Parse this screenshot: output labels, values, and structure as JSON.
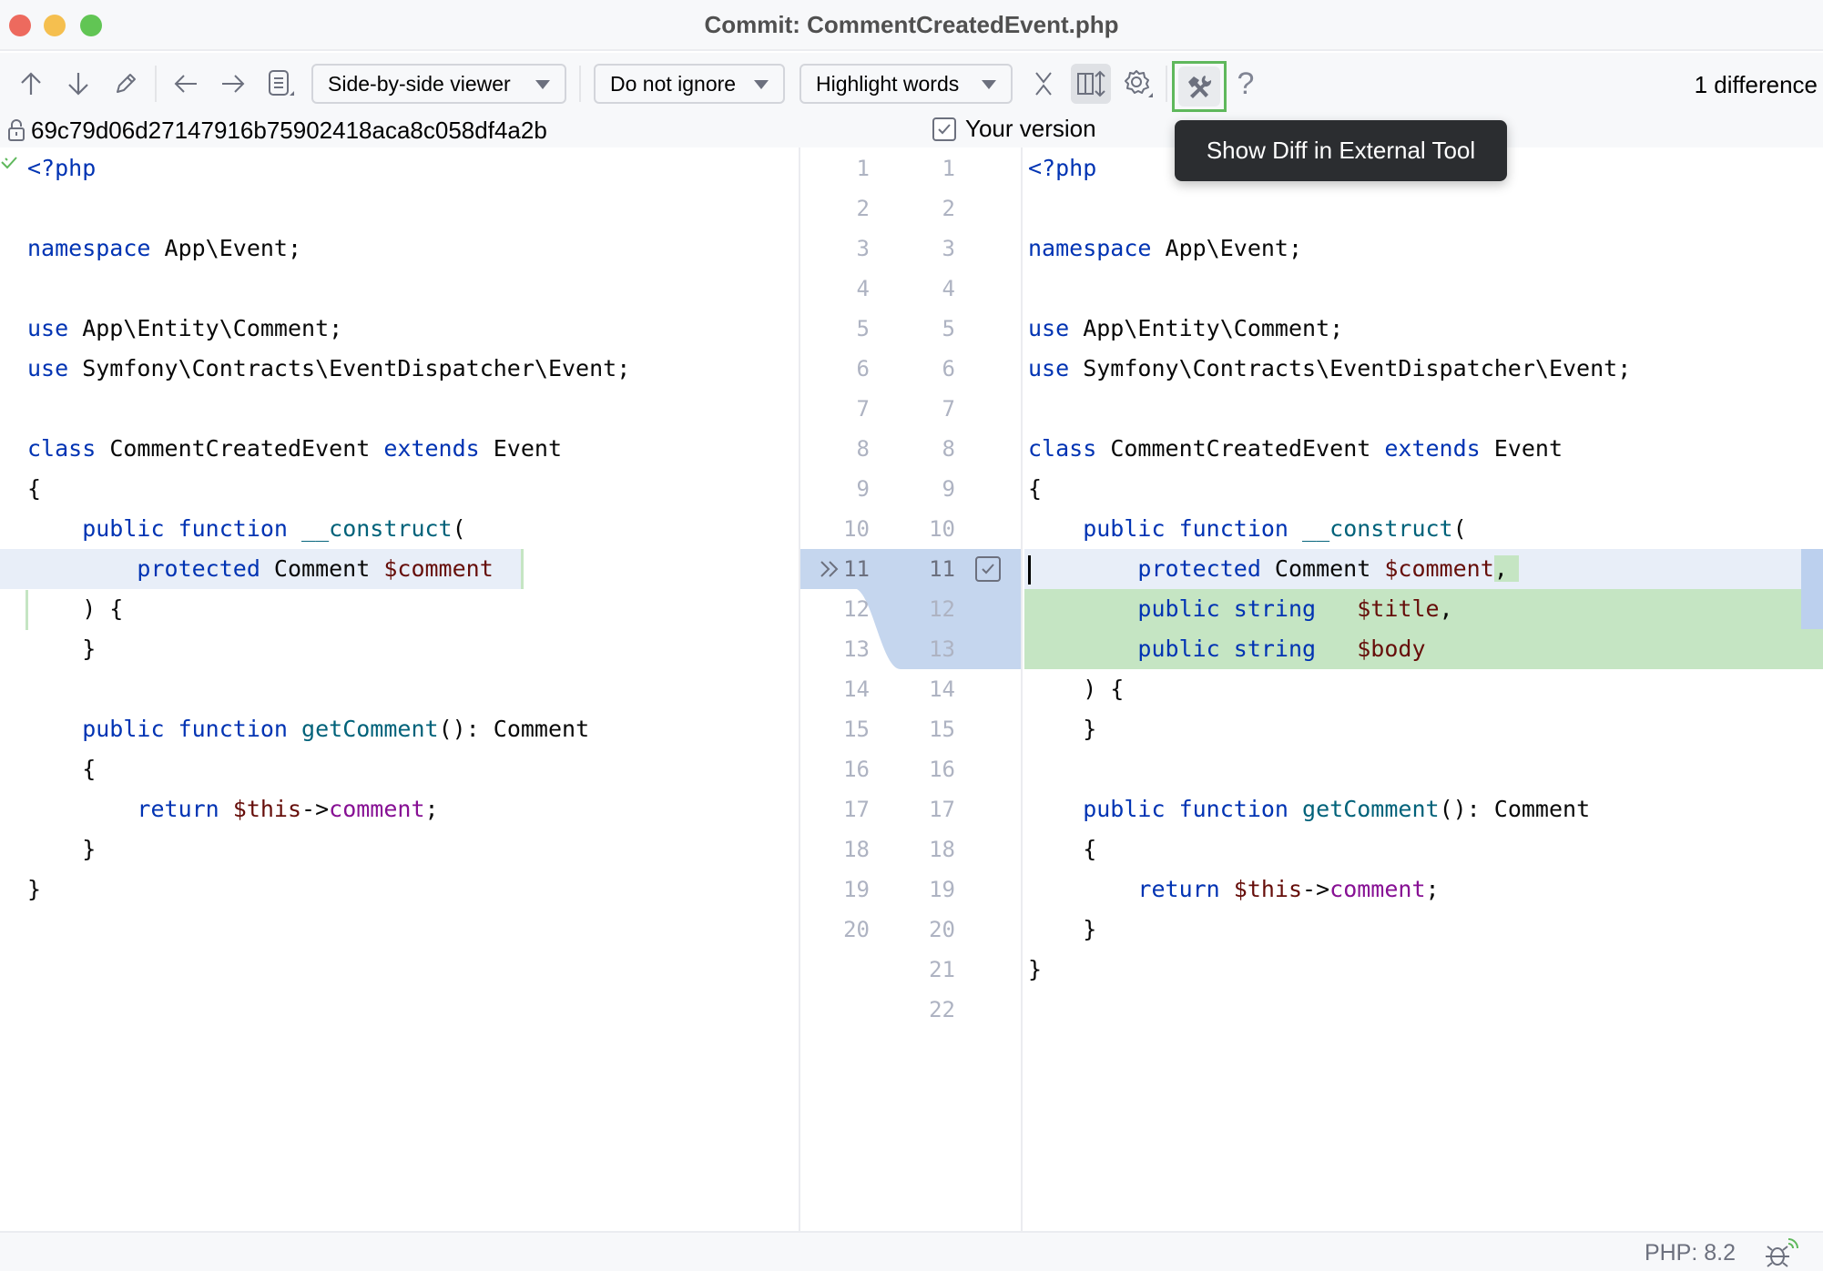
{
  "window": {
    "title": "Commit: CommentCreatedEvent.php"
  },
  "toolbar": {
    "icons": [
      "arrow-up-icon",
      "arrow-down-icon",
      "pencil-icon",
      "arrow-left-icon",
      "arrow-right-icon",
      "document-icon"
    ],
    "viewer_mode": "Side-by-side viewer",
    "whitespace_mode": "Do not ignore",
    "highlight_mode": "Highlight words",
    "difference_count": "1 difference",
    "help_label": "?"
  },
  "tooltip": {
    "text": "Show Diff in External Tool"
  },
  "infobar": {
    "left_revision": "69c79d06d27147916b75902418aca8c058df4a2b",
    "right_label": "Your version",
    "right_checked": true
  },
  "left_lines": [
    [
      {
        "t": "<?php",
        "c": "kw"
      }
    ],
    [],
    [
      {
        "t": "namespace",
        "c": "kw"
      },
      {
        "t": " App\\Event;",
        "c": "plain"
      }
    ],
    [],
    [
      {
        "t": "use",
        "c": "kw"
      },
      {
        "t": " App\\Entity\\Comment;",
        "c": "plain"
      }
    ],
    [
      {
        "t": "use",
        "c": "kw"
      },
      {
        "t": " Symfony\\Contracts\\EventDispatcher\\Event;",
        "c": "plain"
      }
    ],
    [],
    [
      {
        "t": "class",
        "c": "kw"
      },
      {
        "t": " CommentCreatedEvent ",
        "c": "plain"
      },
      {
        "t": "extends",
        "c": "kw"
      },
      {
        "t": " Event",
        "c": "plain"
      }
    ],
    [
      {
        "t": "{",
        "c": "plain"
      }
    ],
    [
      {
        "t": "    public function",
        "c": "kw"
      },
      {
        "t": " ",
        "c": "plain"
      },
      {
        "t": "__construct",
        "c": "fn"
      },
      {
        "t": "(",
        "c": "plain"
      }
    ],
    [
      {
        "t": "        protected",
        "c": "kw"
      },
      {
        "t": " Comment ",
        "c": "plain"
      },
      {
        "t": "$comment",
        "c": "dvar"
      }
    ],
    [
      {
        "t": "    ) {",
        "c": "plain"
      }
    ],
    [
      {
        "t": "    }",
        "c": "plain"
      }
    ],
    [],
    [
      {
        "t": "    public function",
        "c": "kw"
      },
      {
        "t": " ",
        "c": "plain"
      },
      {
        "t": "getComment",
        "c": "fn"
      },
      {
        "t": "(): Comment",
        "c": "plain"
      }
    ],
    [
      {
        "t": "    {",
        "c": "plain"
      }
    ],
    [
      {
        "t": "        return",
        "c": "kw"
      },
      {
        "t": " ",
        "c": "plain"
      },
      {
        "t": "$this",
        "c": "dvar"
      },
      {
        "t": "->",
        "c": "plain"
      },
      {
        "t": "comment",
        "c": "prop"
      },
      {
        "t": ";",
        "c": "plain"
      }
    ],
    [
      {
        "t": "    }",
        "c": "plain"
      }
    ],
    [
      {
        "t": "}",
        "c": "plain"
      }
    ],
    []
  ],
  "right_lines": [
    [
      {
        "t": "<?php",
        "c": "kw"
      }
    ],
    [],
    [
      {
        "t": "namespace",
        "c": "kw"
      },
      {
        "t": " App\\Event;",
        "c": "plain"
      }
    ],
    [],
    [
      {
        "t": "use",
        "c": "kw"
      },
      {
        "t": " App\\Entity\\Comment;",
        "c": "plain"
      }
    ],
    [
      {
        "t": "use",
        "c": "kw"
      },
      {
        "t": " Symfony\\Contracts\\EventDispatcher\\Event;",
        "c": "plain"
      }
    ],
    [],
    [
      {
        "t": "class",
        "c": "kw"
      },
      {
        "t": " CommentCreatedEvent ",
        "c": "plain"
      },
      {
        "t": "extends",
        "c": "kw"
      },
      {
        "t": " Event",
        "c": "plain"
      }
    ],
    [
      {
        "t": "{",
        "c": "plain"
      }
    ],
    [
      {
        "t": "    public function",
        "c": "kw"
      },
      {
        "t": " ",
        "c": "plain"
      },
      {
        "t": "__construct",
        "c": "fn"
      },
      {
        "t": "(",
        "c": "plain"
      }
    ],
    [
      {
        "t": "        protected",
        "c": "kw"
      },
      {
        "t": " Comment ",
        "c": "plain"
      },
      {
        "t": "$comment",
        "c": "dvar"
      },
      {
        "t": ",",
        "c": "plain"
      }
    ],
    [
      {
        "t": "        public string",
        "c": "kw"
      },
      {
        "t": "   ",
        "c": "plain"
      },
      {
        "t": "$title",
        "c": "dvar"
      },
      {
        "t": ",",
        "c": "plain"
      }
    ],
    [
      {
        "t": "        public string",
        "c": "kw"
      },
      {
        "t": "   ",
        "c": "plain"
      },
      {
        "t": "$body",
        "c": "dvar"
      }
    ],
    [
      {
        "t": "    ) {",
        "c": "plain"
      }
    ],
    [
      {
        "t": "    }",
        "c": "plain"
      }
    ],
    [],
    [
      {
        "t": "    public function",
        "c": "kw"
      },
      {
        "t": " ",
        "c": "plain"
      },
      {
        "t": "getComment",
        "c": "fn"
      },
      {
        "t": "(): Comment",
        "c": "plain"
      }
    ],
    [
      {
        "t": "    {",
        "c": "plain"
      }
    ],
    [
      {
        "t": "        return",
        "c": "kw"
      },
      {
        "t": " ",
        "c": "plain"
      },
      {
        "t": "$this",
        "c": "dvar"
      },
      {
        "t": "->",
        "c": "plain"
      },
      {
        "t": "comment",
        "c": "prop"
      },
      {
        "t": ";",
        "c": "plain"
      }
    ],
    [
      {
        "t": "    }",
        "c": "plain"
      }
    ],
    [
      {
        "t": "}",
        "c": "plain"
      }
    ],
    []
  ],
  "gutter": {
    "left_count": 20,
    "right_count": 22,
    "modified_line": 11,
    "added_lines": [
      12,
      13
    ]
  },
  "statusbar": {
    "php_version": "PHP: 8.2"
  },
  "colors": {
    "modified_bg": "#e8eef8",
    "added_bg": "#c5e5c3",
    "gutter_change": "#c5d6ee",
    "highlight_border": "#5fb85c"
  }
}
